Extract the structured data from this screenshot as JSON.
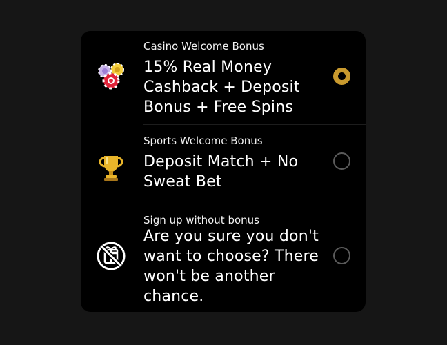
{
  "options": [
    {
      "label": "Casino Welcome Bonus",
      "description": "15% Real Money Cashback + Deposit Bonus + Free Spins",
      "icon": "casino-chips-icon",
      "selected": true
    },
    {
      "label": "Sports Welcome Bonus",
      "description": "Deposit Match + No Sweat Bet",
      "icon": "trophy-icon",
      "selected": false
    },
    {
      "label": "Sign up without bonus",
      "description": "Are you sure you don't want to choose? There won't be another chance.",
      "icon": "no-bonus-icon",
      "selected": false
    }
  ],
  "colors": {
    "page_background": "#161616",
    "panel_background": "#000000",
    "accent": "#c99a2e",
    "radio_border": "#5a5a5a",
    "text": "#ffffff"
  }
}
